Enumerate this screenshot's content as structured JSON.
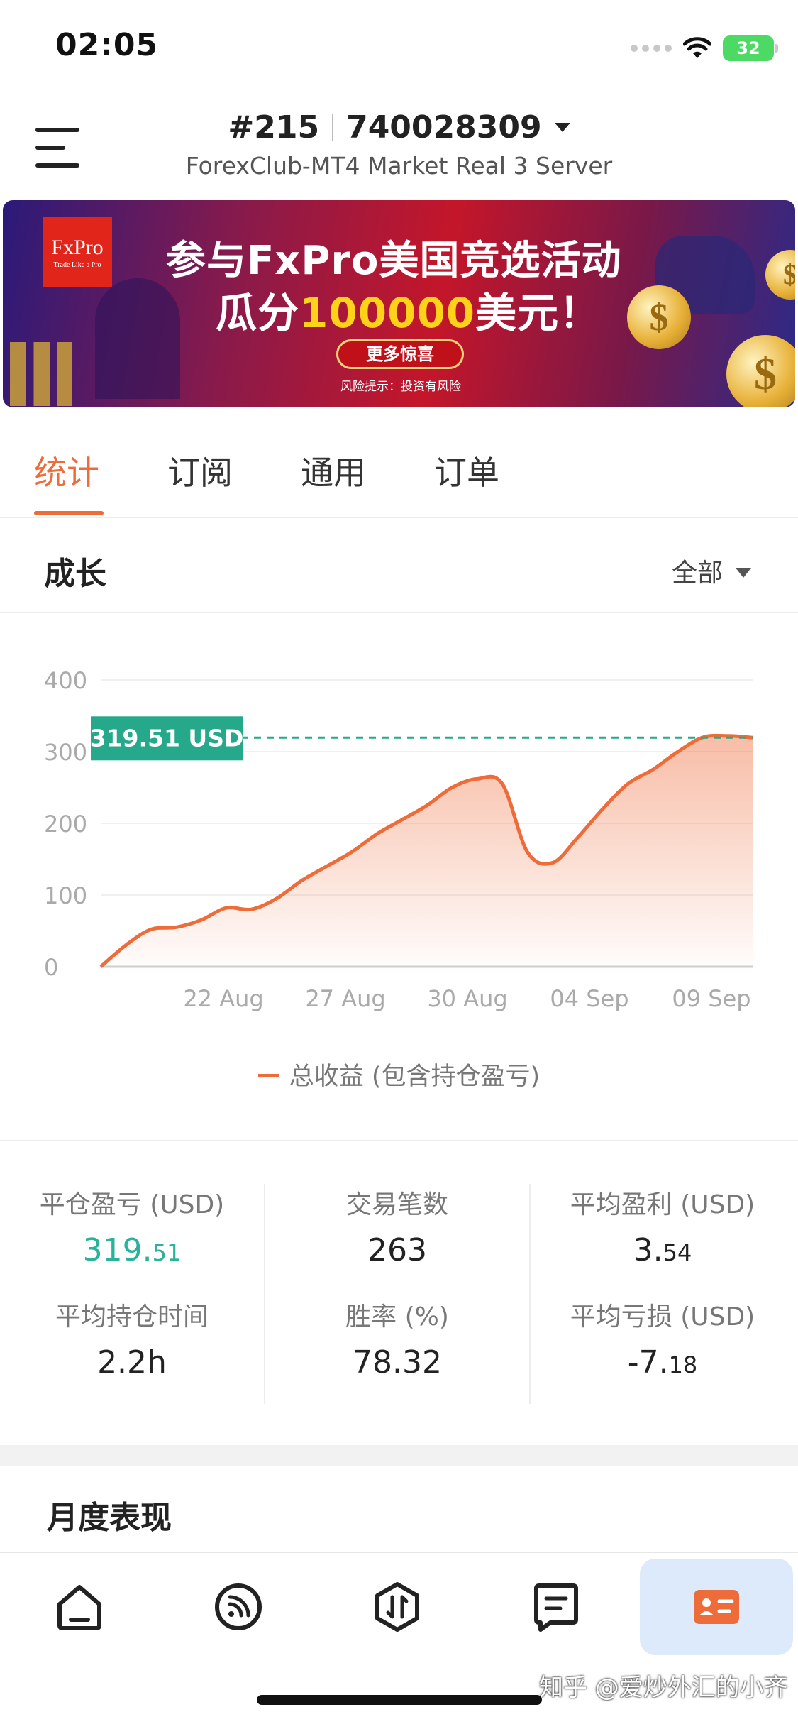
{
  "status_bar": {
    "time": "02:05",
    "battery": "32"
  },
  "header": {
    "account_index": "#215",
    "account_number": "740028309",
    "server": "ForexClub-MT4 Market Real 3 Server"
  },
  "banner": {
    "logo_text": "FxPro",
    "logo_tagline": "Trade Like a Pro",
    "title_line1": "参与FxPro美国竞选活动",
    "title_line2_prefix": "瓜分",
    "title_line2_highlight": "100000",
    "title_line2_suffix": "美元！",
    "button_label": "更多惊喜",
    "risk_note": "风险提示：投资有风险"
  },
  "tabs": [
    {
      "label": "统计",
      "active": true
    },
    {
      "label": "订阅",
      "active": false
    },
    {
      "label": "通用",
      "active": false
    },
    {
      "label": "订单",
      "active": false
    }
  ],
  "growth": {
    "title": "成长",
    "filter": "全部"
  },
  "chart_data": {
    "type": "area",
    "ylim": [
      0,
      400
    ],
    "yticks": [
      "0",
      "100",
      "200",
      "300",
      "400"
    ],
    "x_tick_labels": [
      "22 Aug",
      "27 Aug",
      "30 Aug",
      "04 Sep",
      "09 Sep"
    ],
    "series": [
      {
        "name": "总收益 (包含持仓盈亏)",
        "color": "#ee6c3a",
        "values": [
          0,
          30,
          52,
          55,
          65,
          82,
          80,
          95,
          120,
          140,
          160,
          185,
          205,
          225,
          250,
          262,
          255,
          160,
          145,
          180,
          220,
          255,
          275,
          300,
          320,
          322,
          319.51
        ]
      }
    ],
    "current_value_label": "319.51 USD",
    "current_value": 319.51,
    "label_color": "#25a98a"
  },
  "stats": {
    "closed_pl_label": "平仓盈亏 (USD)",
    "closed_pl_int": "319.",
    "closed_pl_dec": "51",
    "trades_label": "交易笔数",
    "trades_value": "263",
    "avg_profit_label": "平均盈利 (USD)",
    "avg_profit_int": "3.",
    "avg_profit_dec": "54",
    "avg_hold_label": "平均持仓时间",
    "avg_hold_value": "2.2h",
    "win_rate_label": "胜率 (%)",
    "win_rate_value": "78.32",
    "avg_loss_label": "平均亏损 (USD)",
    "avg_loss_int": "-7.",
    "avg_loss_dec": "18"
  },
  "monthly": {
    "title": "月度表现"
  },
  "nav": [
    "home-icon",
    "feed-icon",
    "trade-icon",
    "orders-icon",
    "profile-card-icon"
  ],
  "watermark": "知乎 @爱炒外汇的小齐",
  "colors": {
    "accent": "#ee6c3a",
    "green": "#2bb39a",
    "nav_active_bg": "#dceafc"
  }
}
